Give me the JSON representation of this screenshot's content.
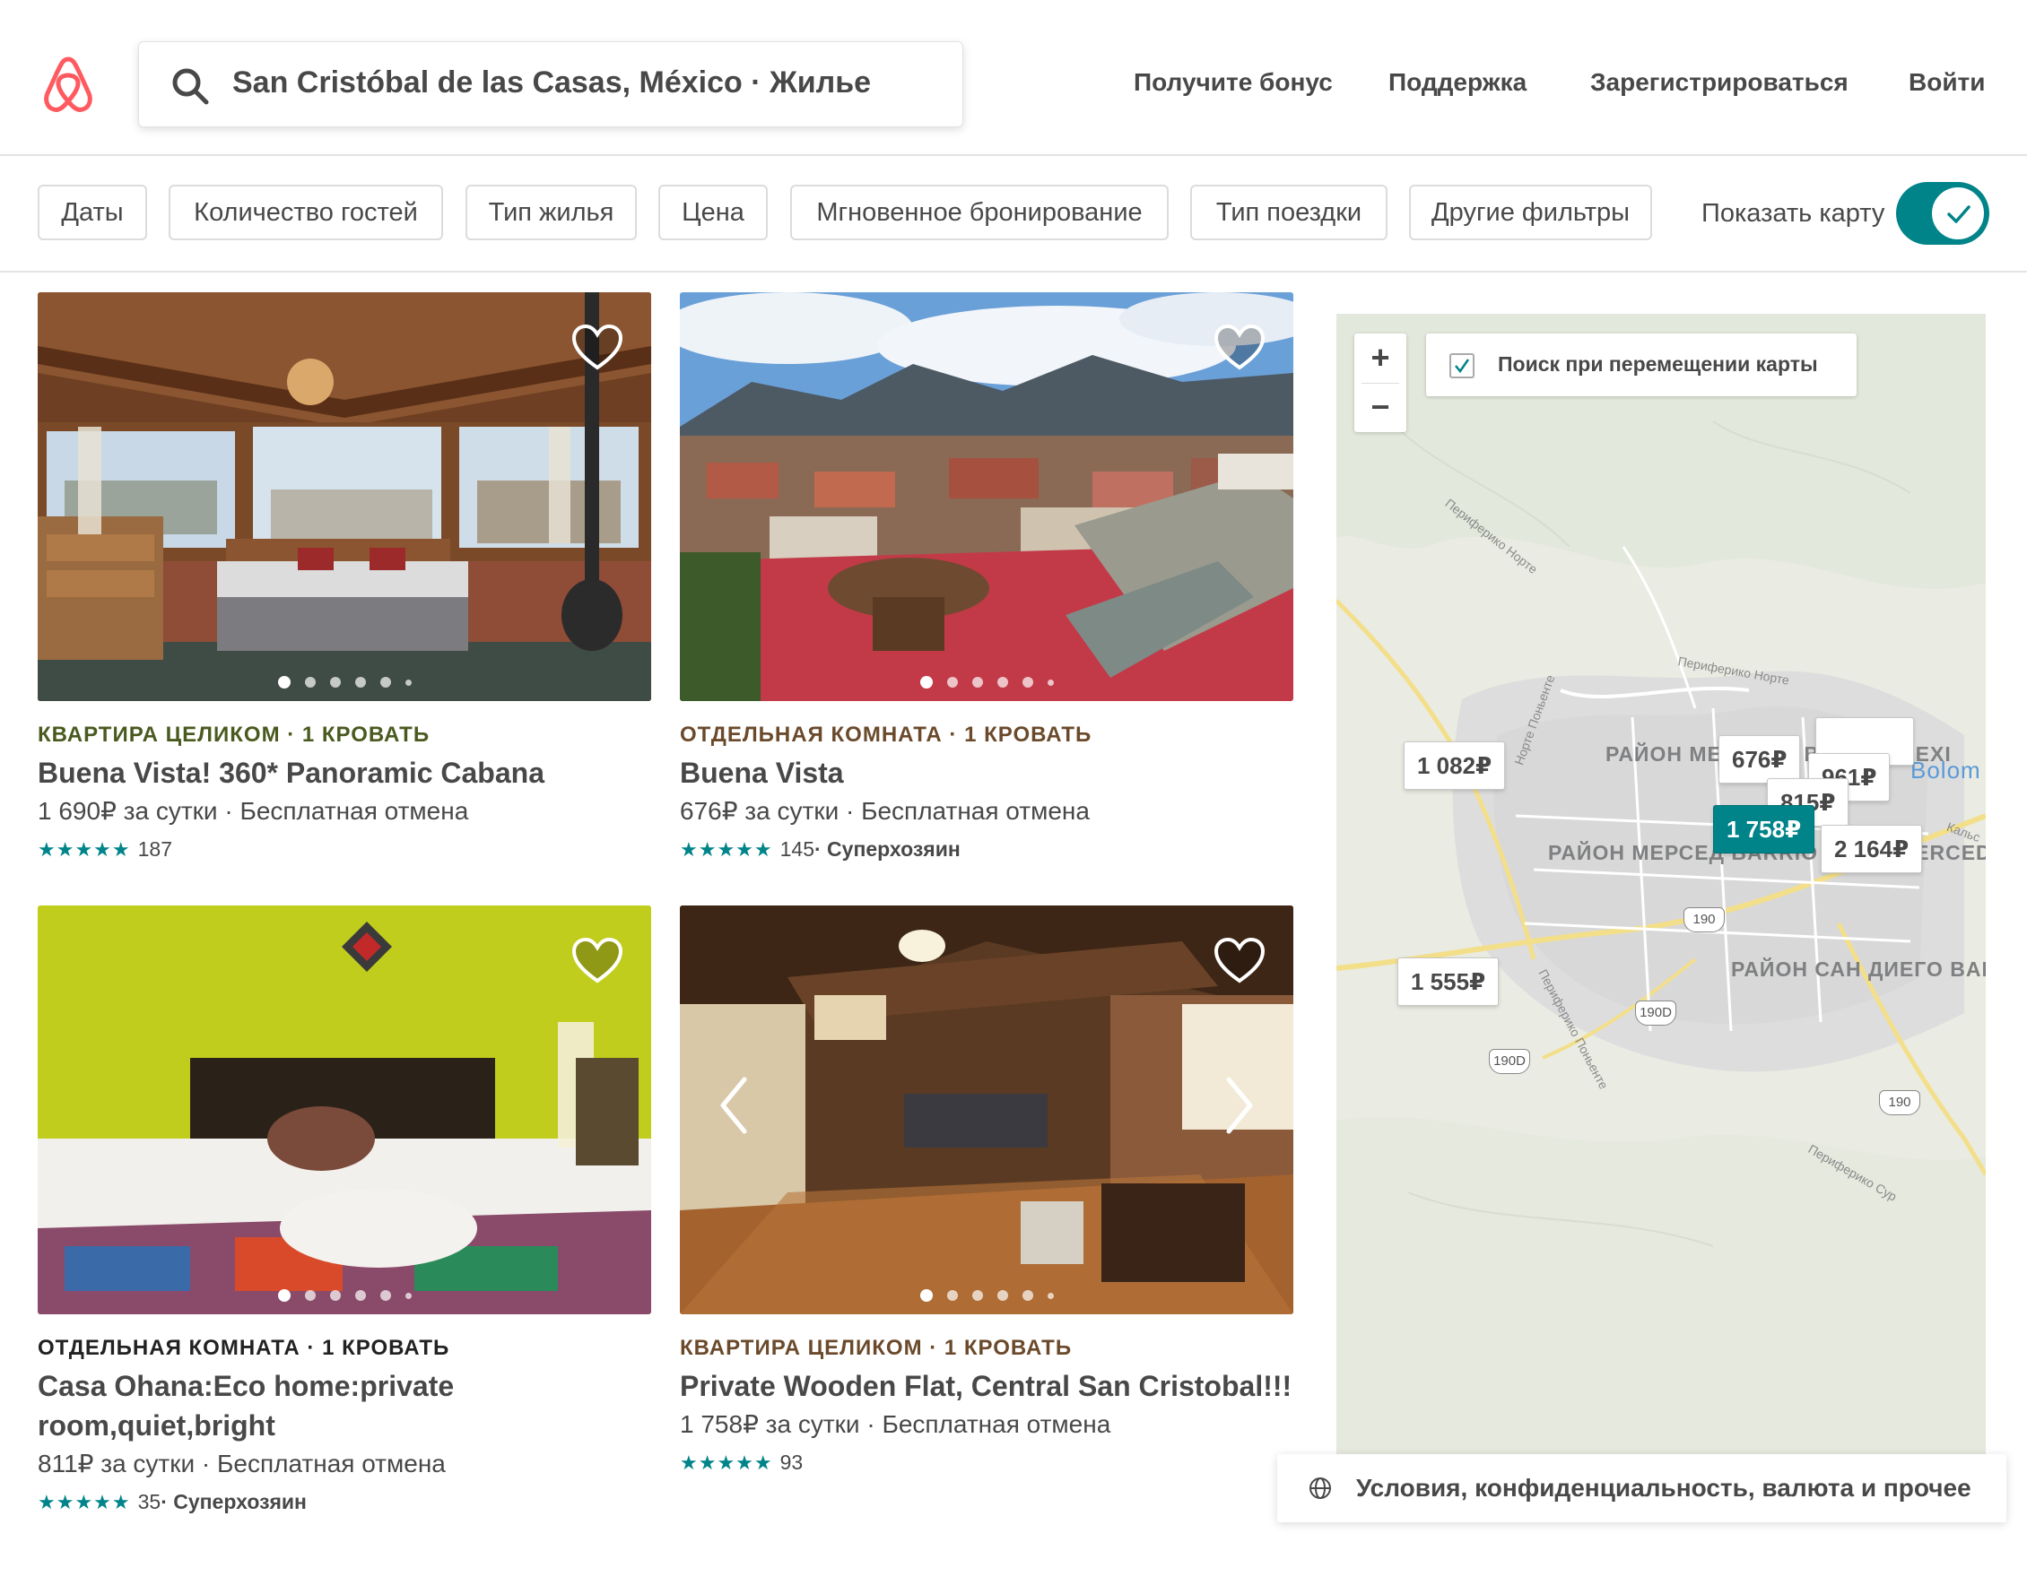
{
  "header": {
    "search_text": "San Cristóbal de las Casas, México · Жилье",
    "nav": [
      "Получите бонус",
      "Поддержка",
      "Зарегистрироваться",
      "Войти"
    ]
  },
  "filters": {
    "pills": [
      "Даты",
      "Количество гостей",
      "Тип жилья",
      "Цена",
      "Мгновенное бронирование",
      "Тип поездки",
      "Другие фильтры"
    ],
    "map_toggle_label": "Показать карту",
    "map_toggle_on": true
  },
  "listings": [
    {
      "kind": "КВАРТИРА ЦЕЛИКОМ · 1 КРОВАТЬ",
      "kind_color": "#4a5a1f",
      "title": "Buena Vista! 360* Panoramic Cabana",
      "price": "1 690₽  за сутки · Бесплатная отмена",
      "stars": "★★★★★",
      "reviews": "187",
      "extra": ""
    },
    {
      "kind": "ОТДЕЛЬНАЯ КОМНАТА · 1 КРОВАТЬ",
      "kind_color": "#6b4a2b",
      "title": "Buena Vista",
      "price": "676₽  за сутки · Бесплатная отмена",
      "stars": "★★★★★",
      "reviews": "145",
      "extra": " · Суперхозяин"
    },
    {
      "kind": "ОТДЕЛЬНАЯ КОМНАТА · 1 КРОВАТЬ",
      "kind_color": "#222222",
      "title": "Casa Ohana:Eco home:private room,quiet,bright",
      "price": "811₽  за сутки · Бесплатная отмена",
      "stars": "★★★★★",
      "reviews": "35",
      "extra": " · Суперхозяин"
    },
    {
      "kind": "КВАРТИРА ЦЕЛИКОМ · 1 КРОВАТЬ",
      "kind_color": "#6b4a2b",
      "title": "Private Wooden Flat, Central San Cristobal!!!",
      "price": "1 758₽  за сутки · Бесплатная отмена",
      "stars": "★★★★★",
      "reviews": "93",
      "extra": ""
    }
  ],
  "map": {
    "zoom_in": "+",
    "zoom_out": "−",
    "search_on_move": "Поиск при перемещении карты",
    "markers": [
      "1 082₽",
      "676₽",
      "961₽",
      "815₽",
      "1 758₽",
      "2 164₽",
      "1 555₽"
    ],
    "neighborhoods": [
      "РАЙОН МЕХИКАН BARRIO MEXI",
      "РАЙОН МЕРСЕД BARRIO DE LA MERCED",
      "РАЙОН САН ДИЕГО BARRIO DE SAN DIEGO"
    ],
    "roads": [
      "Периферико Норте",
      "Периферико Норте",
      "Норте Поньенте",
      "Периферико Поньенте",
      "Периферико Сур",
      "Кальс"
    ],
    "place": "Bolom",
    "shields": [
      "190",
      "190D",
      "190D",
      "190"
    ]
  },
  "footer": {
    "terms": "Условия, конфиденциальность, валюта и прочее"
  },
  "colors": {
    "brand": "#FF5A5F",
    "accent": "#008489"
  }
}
